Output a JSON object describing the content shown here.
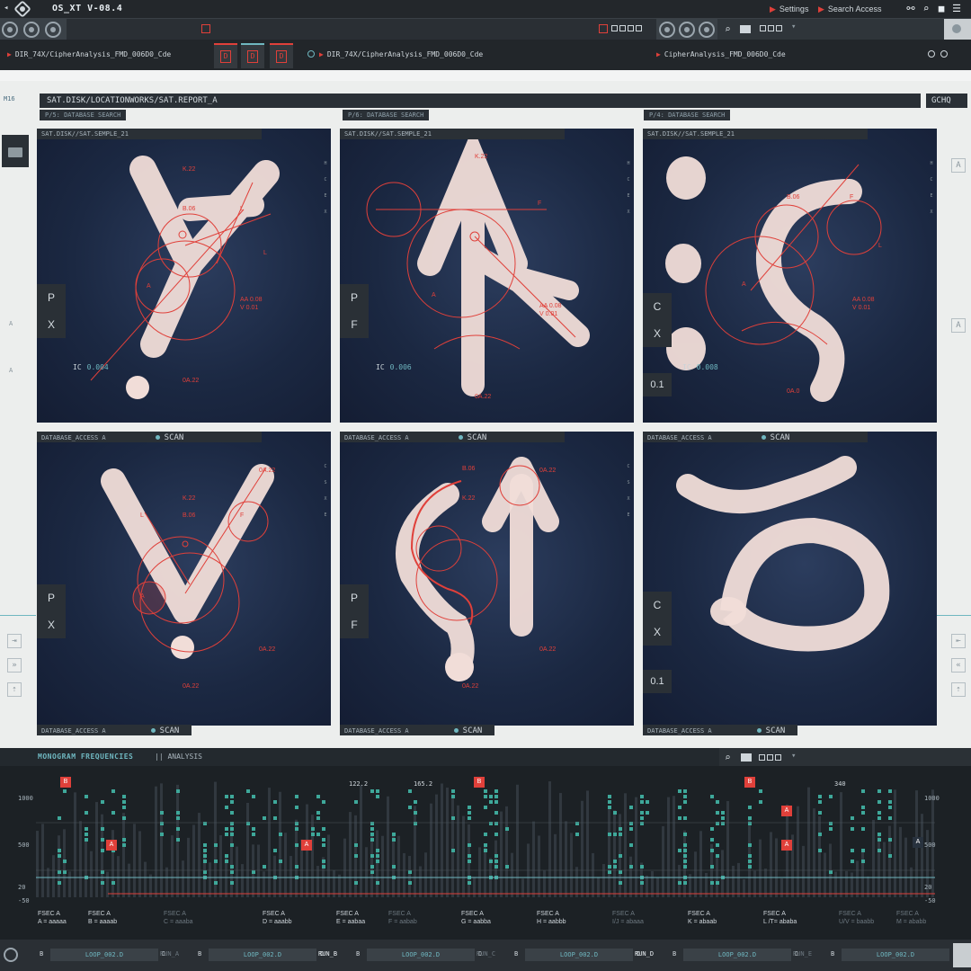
{
  "app": {
    "title": "OS_XT V-08.4"
  },
  "topbar": {
    "settings": "Settings",
    "search_access": "Search Access"
  },
  "dirs": [
    "DIR_74X/CipherAnalysis_FMD_006D0_Cde",
    "DIR_74X/CipherAnalysis_FMD_006D0_Cde",
    "CipherAnalysis_FMD_006D0_Cde"
  ],
  "dir_tab_letter": "D",
  "side": {
    "m16": "M16",
    "a": "A"
  },
  "path": "SAT.DISK/LOCATIONWORKS/SAT.REPORT_A",
  "gchq": "GCHQ",
  "db_search": [
    "P/5: DATABASE SEARCH",
    "P/6: DATABASE SEARCH",
    "P/4: DATABASE SEARCH"
  ],
  "panels": [
    {
      "header": "SAT.DISK//SAT.SEMPLE_21",
      "tabs": [
        "P",
        "X"
      ],
      "ic_label": "IC",
      "ic_value": "0.004",
      "annotations": [
        "K.22",
        "B.06",
        "L",
        "L",
        "A",
        "AA 0.08",
        "V 0.01",
        "0A.22"
      ]
    },
    {
      "header": "SAT.DISK//SAT.SEMPLE_21",
      "tabs": [
        "P",
        "F"
      ],
      "ic_label": "IC",
      "ic_value": "0.006",
      "annotations": [
        "K.22",
        "F",
        "A",
        "AA 0.08",
        "V 0.01",
        "0A.22"
      ]
    },
    {
      "header": "SAT.DISK//SAT.SEMPLE_21",
      "tabs": [
        "C",
        "X"
      ],
      "ic_label": "IC",
      "ic_value": "0.008",
      "extra": "0.1",
      "annotations": [
        "B.06",
        "F",
        "L",
        "A",
        "AA 0.08",
        "V 0.01",
        "0A.0"
      ]
    },
    {
      "header": "DATABASE_ACCESS A",
      "scan": "SCAN",
      "tabs": [
        "P",
        "X"
      ],
      "annotations": [
        "0A.22",
        "K.22",
        "B.06",
        "L",
        "F",
        "A",
        "0A.22",
        "0A.22"
      ]
    },
    {
      "header": "DATABASE_ACCESS A",
      "scan": "SCAN",
      "tabs": [
        "P",
        "F"
      ],
      "annotations": [
        "B.06",
        "K.22",
        "0A.22",
        "0A.22",
        "0A.22"
      ]
    },
    {
      "header": "DATABASE_ACCESS A",
      "scan": "SCAN",
      "tabs": [
        "C",
        "X"
      ],
      "extra": "0.1",
      "annotations": []
    }
  ],
  "bottom_headers": [
    {
      "label": "DATABASE_ACCESS A",
      "scan": "SCAN"
    },
    {
      "label": "DATABASE_ACCESS A",
      "scan": "SCAN"
    },
    {
      "label": "DATABASE_ACCESS A",
      "scan": "SCAN"
    }
  ],
  "right_col_letters": [
    "H",
    "C",
    "E",
    "X",
    "C",
    "S",
    "X",
    "E"
  ],
  "analysis": {
    "title": "MONOGRAM FREQUENCIES",
    "tab": "|| ANALYSIS",
    "y_left": [
      "1000",
      "500",
      "20",
      "-50"
    ],
    "y_right": [
      "1000",
      "500",
      "20",
      "-50"
    ],
    "top_values": [
      "122.2",
      "165.2",
      "340"
    ],
    "markers": [
      "B",
      "B",
      "B",
      "A",
      "A",
      "A",
      "A",
      "A"
    ],
    "dark_marker": "A",
    "fsec": [
      {
        "label": "FSEC A",
        "value": "A = aaaaa",
        "dim": false
      },
      {
        "label": "FSEC A",
        "value": "B = aaaab",
        "dim": false
      },
      {
        "label": "FSEC A",
        "value": "C = aaaba",
        "dim": true
      },
      {
        "label": "FSEC A",
        "value": "D = aaabb",
        "dim": false
      },
      {
        "label": "FSEC A",
        "value": "E = aabaa",
        "dim": false
      },
      {
        "label": "FSEC A",
        "value": "F = aabab",
        "dim": true
      },
      {
        "label": "FSEC A",
        "value": "G = aabba",
        "dim": false
      },
      {
        "label": "FSEC A",
        "value": "H = aabbb",
        "dim": false
      },
      {
        "label": "FSEC A",
        "value": "I/J = abaaa",
        "dim": true
      },
      {
        "label": "FSEC A",
        "value": "K = abaab",
        "dim": false
      },
      {
        "label": "FSEC A",
        "value": "L /T= ababa",
        "dim": false
      },
      {
        "label": "FSEC A",
        "value": "U/V = baabb",
        "dim": true
      },
      {
        "label": "FSEC A",
        "value": "M = ababb",
        "dim": true
      }
    ]
  },
  "footer": {
    "loops": [
      {
        "b": "B",
        "loop": "LOOP_002.D",
        "d": "D",
        "run": "RUN_A",
        "active": false
      },
      {
        "b": "B",
        "loop": "LOOP_002.D",
        "d": "D",
        "run": "RUN_B",
        "active": true
      },
      {
        "b": "B",
        "loop": "LOOP_002.D",
        "d": "D",
        "run": "RUN_C",
        "active": false
      },
      {
        "b": "B",
        "loop": "LOOP_002.D",
        "d": "D",
        "run": "RUN_D",
        "active": true
      },
      {
        "b": "B",
        "loop": "LOOP_002.D",
        "d": "D",
        "run": "RUN_E",
        "active": false
      },
      {
        "b": "B",
        "loop": "LOOP_002.D",
        "d": "D",
        "run": "",
        "active": false
      }
    ]
  },
  "colors": {
    "accent_red": "#e0403a",
    "accent_teal": "#6fb7c0",
    "panel_bg": "#1b2842",
    "bar_dark": "#23272b"
  }
}
